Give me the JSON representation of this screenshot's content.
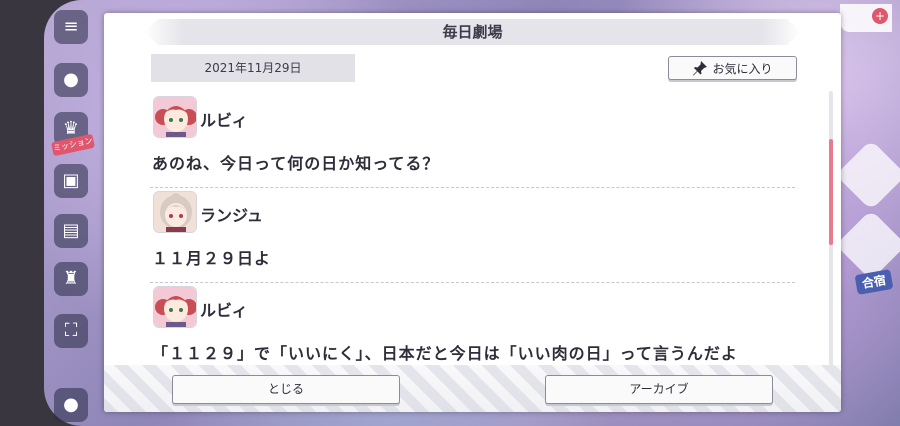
{
  "dialog": {
    "title": "毎日劇場",
    "date": "2021年11月29日",
    "favorite_label": "お気に入り",
    "close_label": "とじる",
    "archive_label": "アーカイブ"
  },
  "entries": [
    {
      "speaker": "ルビィ",
      "line": "あのね、今日って何の日か知ってる？"
    },
    {
      "speaker": "ランジュ",
      "line": "１１月２９日よ"
    },
    {
      "speaker": "ルビィ",
      "line": "「１１２９」で「いいにく」、日本だと今日は「いい肉の日」って言うんだよ"
    }
  ],
  "background": {
    "rail_badge": "ミッション",
    "right_label": "合宿"
  },
  "colors": {
    "accent": "#e77d8c",
    "title_bar": "#e4e4ea",
    "text": "#2e2e3a"
  },
  "icons": {
    "favorite": "pin-icon",
    "menu": "menu-icon"
  }
}
